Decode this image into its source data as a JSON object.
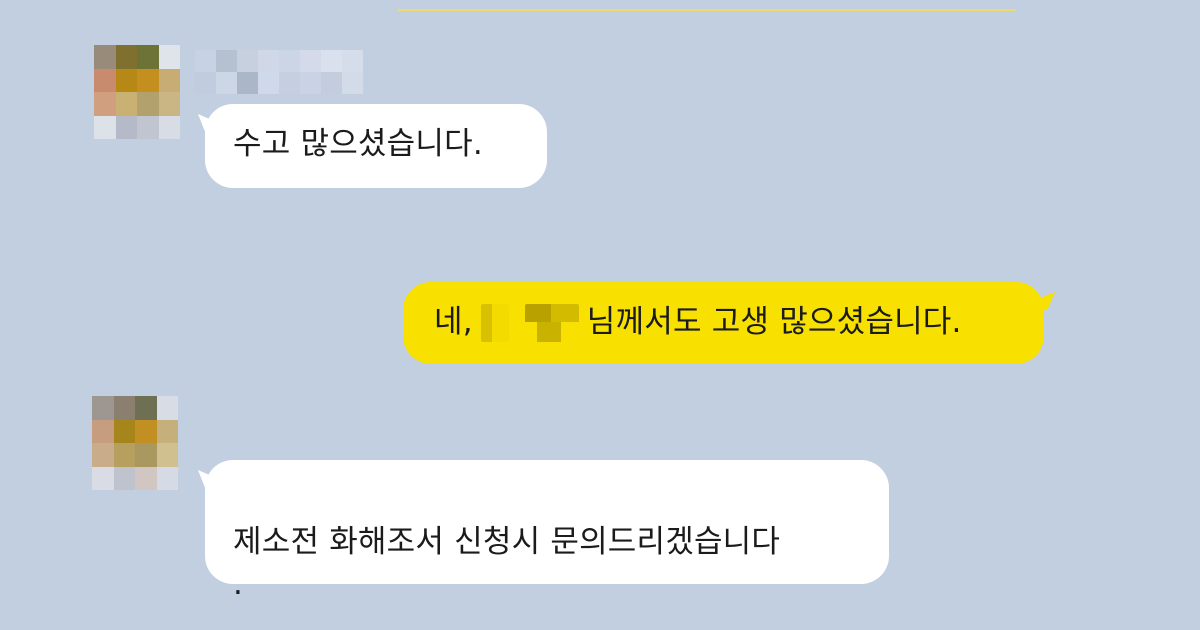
{
  "chat": {
    "messages": [
      {
        "sender": "contact",
        "text": "수고 많으셨습니다."
      },
      {
        "sender": "me",
        "prefix": "네,",
        "suffix": "님께서도 고생 많으셨습니다."
      },
      {
        "sender": "contact",
        "text": "제소전 화해조서 신청시 문의드리겠습니다\n."
      }
    ]
  },
  "colors": {
    "background": "#c2cfe0",
    "incoming_bubble": "#ffffff",
    "outgoing_bubble": "#f8e100",
    "text": "#1b1b1b"
  }
}
